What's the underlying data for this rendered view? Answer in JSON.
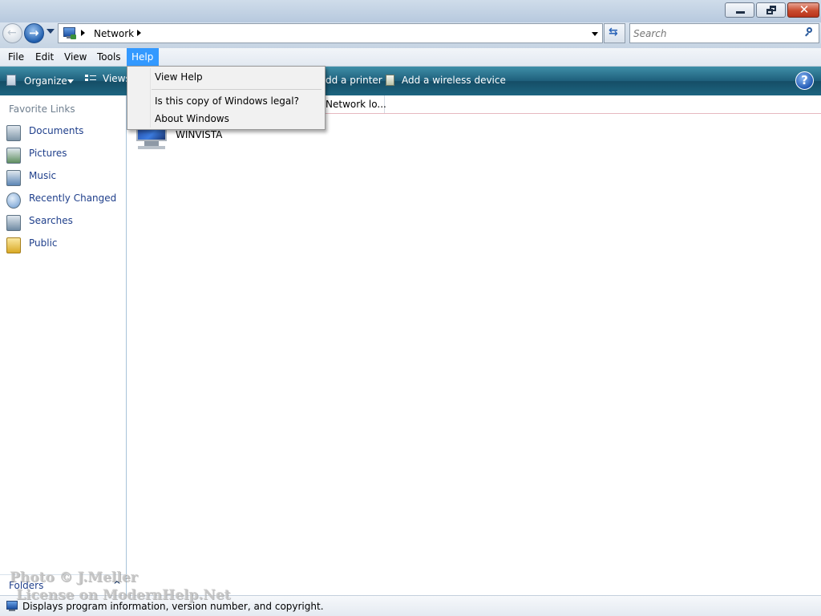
{
  "window": {
    "controls": {
      "minimize_icon": "minimize-icon",
      "restore_icon": "restore-icon",
      "close_icon": "close-icon",
      "close_color": "#c94b2e"
    }
  },
  "address": {
    "location": "Network",
    "search_placeholder": "Search"
  },
  "menubar": {
    "items": [
      "File",
      "Edit",
      "View",
      "Tools",
      "Help"
    ],
    "active": "Help",
    "active_color": "#3399ff"
  },
  "toolbar": {
    "organize": "Organize",
    "views": "Views",
    "add_printer": "dd a printer",
    "add_wireless": "Add a wireless device",
    "color": "#1e5f7b"
  },
  "help_menu": {
    "items": [
      "View Help",
      "Is this copy of Windows legal?",
      "About Windows"
    ]
  },
  "sidebar": {
    "title": "Favorite Links",
    "items": [
      {
        "label": "Documents",
        "icon": "documents-icon"
      },
      {
        "label": "Pictures",
        "icon": "pictures-icon"
      },
      {
        "label": "Music",
        "icon": "music-icon"
      },
      {
        "label": "Recently Changed",
        "icon": "recently-changed-icon"
      },
      {
        "label": "Searches",
        "icon": "searches-icon"
      },
      {
        "label": "Public",
        "icon": "public-folder-icon"
      }
    ],
    "folders_label": "Folders"
  },
  "content": {
    "column_partial": "Network lo...",
    "items": [
      {
        "name": "WINVISTA",
        "icon": "computer-icon"
      }
    ]
  },
  "statusbar": {
    "text": "Displays program information, version number, and copyright."
  },
  "watermark": {
    "line1": "Photo © J.Meller",
    "line2": "License on ModernHelp.Net"
  }
}
